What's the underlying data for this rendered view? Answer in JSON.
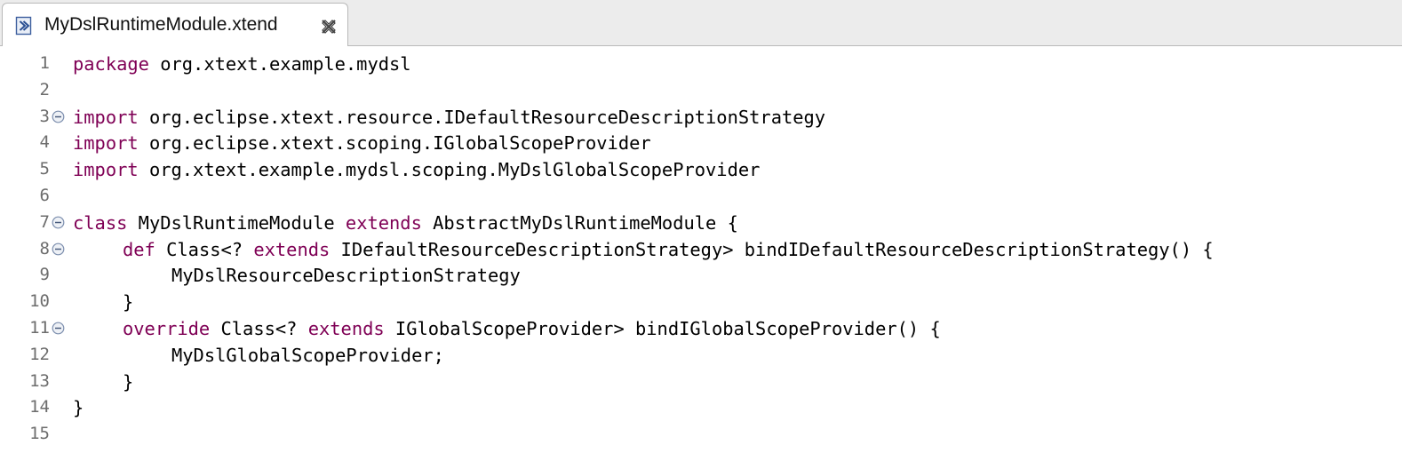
{
  "tab": {
    "title": "MyDslRuntimeModule.xtend",
    "icon": "xtend-file-icon",
    "close_icon": "close-icon"
  },
  "colors": {
    "keyword": "#7f0055",
    "text": "#000000",
    "line_number": "#6d6d6d",
    "tabbar_bg": "#ececec"
  },
  "editor": {
    "lines": [
      {
        "num": "1",
        "indent": 0,
        "kw": "package",
        "rest": " org.xtext.example.mydsl"
      },
      {
        "num": "2",
        "indent": 0,
        "kw": "",
        "rest": ""
      },
      {
        "num": "3",
        "indent": 0,
        "kw": "import",
        "rest": " org.eclipse.xtext.resource.IDefaultResourceDescriptionStrategy"
      },
      {
        "num": "4",
        "indent": 0,
        "kw": "import",
        "rest": " org.eclipse.xtext.scoping.IGlobalScopeProvider"
      },
      {
        "num": "5",
        "indent": 0,
        "kw": "import",
        "rest": " org.xtext.example.mydsl.scoping.MyDslGlobalScopeProvider"
      },
      {
        "num": "6",
        "indent": 0,
        "kw": "",
        "rest": ""
      },
      {
        "num": "7",
        "indent": 0,
        "kw": "class",
        "rest": " MyDslRuntimeModule ",
        "kw2": "extends",
        "rest2": " AbstractMyDslRuntimeModule {"
      },
      {
        "num": "8",
        "indent": 1,
        "kw": "def",
        "rest": " Class<? ",
        "kw2": "extends",
        "rest2": " IDefaultResourceDescriptionStrategy> bindIDefaultResourceDescriptionStrategy() {"
      },
      {
        "num": "9",
        "indent": 2,
        "kw": "",
        "rest": "MyDslResourceDescriptionStrategy"
      },
      {
        "num": "10",
        "indent": 1,
        "kw": "",
        "rest": "}"
      },
      {
        "num": "11",
        "indent": 1,
        "kw": "override",
        "rest": " Class<? ",
        "kw2": "extends",
        "rest2": " IGlobalScopeProvider> bindIGlobalScopeProvider() {"
      },
      {
        "num": "12",
        "indent": 2,
        "kw": "",
        "rest": "MyDslGlobalScopeProvider;"
      },
      {
        "num": "13",
        "indent": 1,
        "kw": "",
        "rest": "}"
      },
      {
        "num": "14",
        "indent": 0,
        "kw": "",
        "rest": "}"
      },
      {
        "num": "15",
        "indent": 0,
        "kw": "",
        "rest": ""
      }
    ],
    "fold_markers": [
      "3",
      "7",
      "8",
      "11"
    ]
  }
}
